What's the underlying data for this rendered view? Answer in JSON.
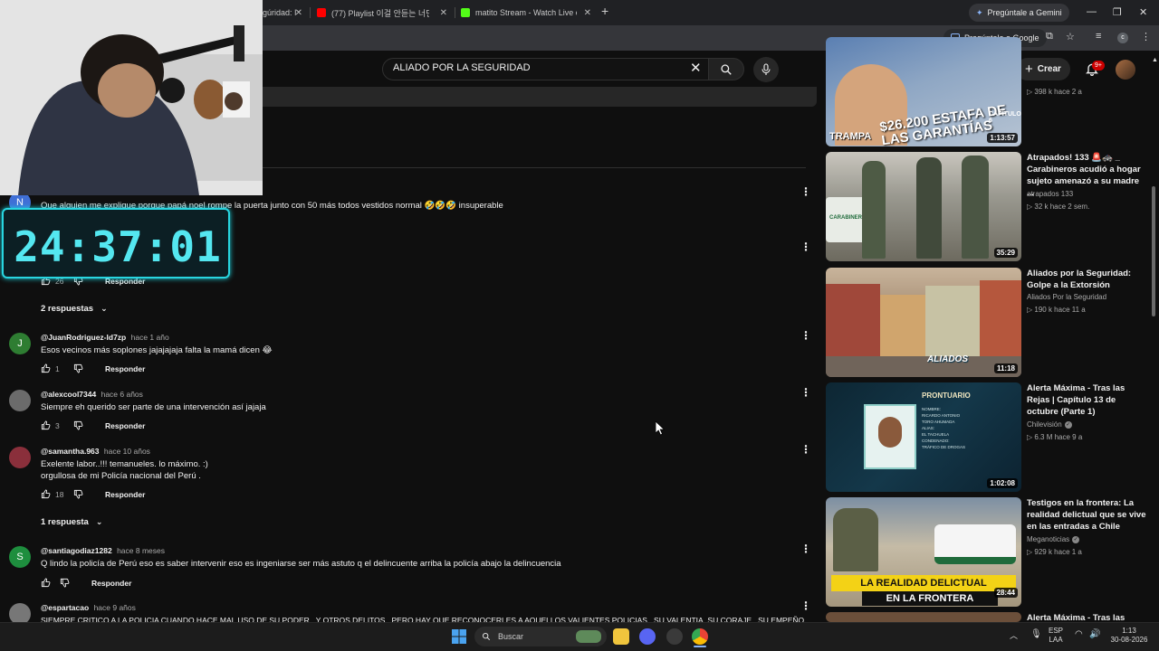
{
  "browser": {
    "tabs": [
      {
        "label": "gúridad: I"
      },
      {
        "label": "(77) Playlist 이걸 안듣는 너만 손"
      },
      {
        "label": "matito Stream - Watch Live on K"
      }
    ],
    "gemini_label": "Pregúntale a Gemini",
    "google_pill": "Pregúntale a Google",
    "profile_letter": "c"
  },
  "masthead": {
    "search_query": "ALIADO POR LA SEGURIDAD",
    "create_label": "Crear",
    "notifications_badge": "9+"
  },
  "overlay": {
    "timer": "24:37:01"
  },
  "comments": [
    {
      "avatar": "N",
      "avatar_color": "#3f6fd6",
      "author": "",
      "time": "",
      "text": "Que alguien me explique porque papá noel rompe la puerta junto con 50 más todos vestidos normal 🤣🤣🤣 insuperable",
      "likes": "26",
      "reply": "Responder"
    },
    {
      "avatar": "J",
      "avatar_color": "#2e7d32",
      "author": "@JuanRodriguez-ld7zp",
      "time": "hace 1 año",
      "text": "Esos vecinos más soplones jajajajaja falta la mamá dicen 😂",
      "likes": "1",
      "reply": "Responder"
    },
    {
      "avatar": "",
      "avatar_color": "#6b6b6b",
      "author": "@alexcool7344",
      "time": "hace 6 años",
      "text": "Siempre eh querido ser parte de una intervención así jajaja",
      "likes": "3",
      "reply": "Responder"
    },
    {
      "avatar": "",
      "avatar_color": "#8a2f3b",
      "author": "@samantha.963",
      "time": "hace 10 años",
      "text": "Exelente labor..!!!  temanueles. lo máximo. :)",
      "text2": "orgullosa de mi Policía nacional del Perú .",
      "likes": "18",
      "reply": "Responder"
    },
    {
      "avatar": "S",
      "avatar_color": "#1e8e3e",
      "author": "@santiagodiaz1282",
      "time": "hace 8 meses",
      "text": "Q lindo la policía de Perú eso es saber intervenir eso es ingeniarse ser más astuto q el delincuente arriba la policía abajo la delincuencia",
      "likes": "",
      "reply": "Responder"
    },
    {
      "avatar": "",
      "avatar_color": "#777777",
      "author": "@espartacao",
      "time": "hace 9 años",
      "text": "SIEMPRE CRITICO A LA POLICIA CUANDO HACE MAL USO DE SU PODER , Y OTROS DELITOS , PERO HAY QUE RECONOCERLES A AQUELLOS VALIENTES POLICIAS , SU VALENTIA, SU CORAJE , SU EMPEÑO",
      "likes": "",
      "reply": ""
    }
  ],
  "replies_toggles": [
    {
      "label": "2 respuestas"
    },
    {
      "label": "1 respuesta"
    }
  ],
  "videos": [
    {
      "title": "",
      "channel": "",
      "meta": "▷ 398 k  hace 2 a",
      "duration": "1:13:57",
      "thumb_text": "$26.200 ESTAFA DE LAS GARANTÍAS",
      "thumb_sub": "CAPÍTULO 6",
      "thumb_brand": "TRAMPA"
    },
    {
      "title": "Atrapados! 133 🚨🚓 _ Carabineros acudió a hogar sujeto amenazó a su madre ...",
      "channel": "atrapados 133",
      "meta": "▷ 32 k  hace 2 sem.",
      "duration": "35:29",
      "thumb_text": "CARABINEROS"
    },
    {
      "title": "Aliados por la Seguridad: Golpe a la Extorsión",
      "channel": "Aliados Por la Seguridad",
      "meta": "▷ 190 k  hace 11 a",
      "duration": "11:18",
      "thumb_text": "ALIADOS"
    },
    {
      "title": "Alerta Máxima - Tras las Rejas | Capítulo 13 de octubre (Parte 1)",
      "channel": "Chilevisión",
      "meta": "▷ 6.3 M  hace 9 a",
      "duration": "1:02:08",
      "thumb_text": "PRONTUARIO",
      "thumb_lines": [
        "NOMBRE:",
        "RICARDO ANTONIO",
        "TORO AHUMADA",
        "ALIAS:",
        "EL TACHUELA",
        "CONDENADO:",
        "TRÁFICO DE DROGAS"
      ]
    },
    {
      "title": "Testigos en la frontera: La realidad delictual que se vive en las entradas a Chile",
      "channel": "Meganoticias",
      "meta": "▷ 929 k  hace 1 a",
      "duration": "28:44",
      "thumb_text": "LA REALIDAD DELICTUAL",
      "thumb_sub": "EN LA FRONTERA"
    },
    {
      "title": "Alerta Máxima - Tras las",
      "channel": "",
      "meta": "",
      "duration": ""
    }
  ],
  "taskbar": {
    "search_placeholder": "Buscar",
    "lang": "ESP",
    "lang2": "LAA",
    "time": "1:13",
    "date": "30-08-2026"
  },
  "colors": {
    "background": "#0f0f0f",
    "timer_accent": "#54e7f0",
    "badge_red": "#cc0000"
  }
}
